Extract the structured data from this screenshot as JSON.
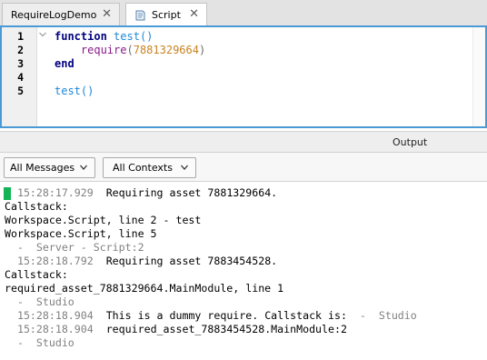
{
  "tabs": [
    {
      "label": "RequireLogDemo",
      "close": "✕"
    },
    {
      "label": "Script",
      "close": "✕"
    }
  ],
  "editor": {
    "line_numbers": [
      "1",
      "2",
      "3",
      "4",
      "5"
    ],
    "code": {
      "l1_kw": "function",
      "l1_name": "test",
      "l1_parens": "()",
      "l2_indent": "    ",
      "l2_call": "require",
      "l2_open": "(",
      "l2_num": "7881329664",
      "l2_close": ")",
      "l3_kw": "end",
      "l5_name": "test",
      "l5_parens": "()"
    }
  },
  "output": {
    "title": "Output",
    "filter_messages": "All Messages",
    "filter_contexts": "All Contexts",
    "lines": [
      {
        "ts": "15:28:17.929",
        "msg": "Requiring asset 7881329664."
      },
      {
        "text": "Callstack:"
      },
      {
        "text": "Workspace.Script, line 2 - test"
      },
      {
        "text": "Workspace.Script, line 5"
      },
      {
        "text": "  -  Server - Script:2"
      },
      {
        "ts": "15:28:18.792",
        "msg": "Requiring asset 7883454528."
      },
      {
        "text": "Callstack:"
      },
      {
        "text": "required_asset_7881329664.MainModule, line 1"
      },
      {
        "text": "  -  Studio"
      },
      {
        "ts": "15:28:18.904",
        "msg": "This is a dummy require. Callstack is:",
        "tail": "  -  Studio"
      },
      {
        "ts": "15:28:18.904",
        "msg": "required_asset_7883454528.MainModule:2"
      },
      {
        "text": "  -  Studio"
      }
    ]
  }
}
